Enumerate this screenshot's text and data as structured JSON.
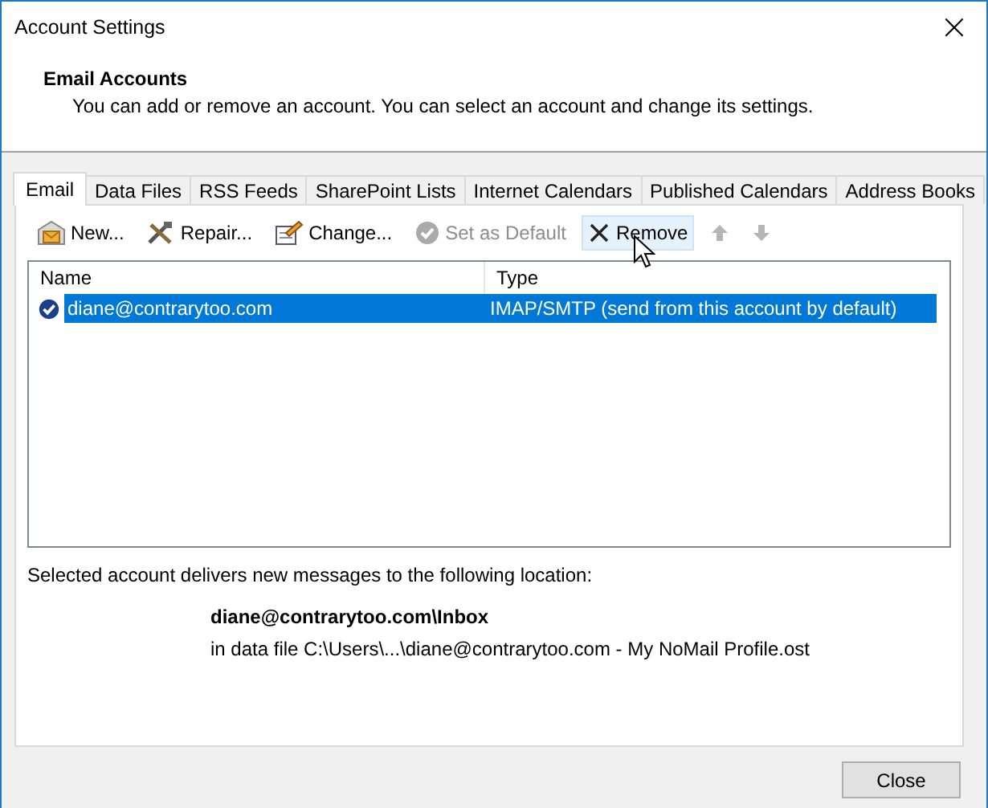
{
  "window": {
    "title": "Account Settings",
    "close": "×"
  },
  "header": {
    "title": "Email Accounts",
    "description": "You can add or remove an account. You can select an account and change its settings."
  },
  "tabs": [
    {
      "label": "Email",
      "selected": true
    },
    {
      "label": "Data Files",
      "selected": false
    },
    {
      "label": "RSS Feeds",
      "selected": false
    },
    {
      "label": "SharePoint Lists",
      "selected": false
    },
    {
      "label": "Internet Calendars",
      "selected": false
    },
    {
      "label": "Published Calendars",
      "selected": false
    },
    {
      "label": "Address Books",
      "selected": false
    }
  ],
  "toolbar": [
    {
      "kind": "new",
      "label": "New...",
      "disabled": false,
      "hovered": false
    },
    {
      "kind": "repair",
      "label": "Repair...",
      "disabled": false,
      "hovered": false
    },
    {
      "kind": "change",
      "label": "Change...",
      "disabled": false,
      "hovered": false
    },
    {
      "kind": "default",
      "label": "Set as Default",
      "disabled": true,
      "hovered": false
    },
    {
      "kind": "remove",
      "label": "Remove",
      "disabled": false,
      "hovered": true
    },
    {
      "kind": "up",
      "disabled": true,
      "hovered": false
    },
    {
      "kind": "down",
      "disabled": true,
      "hovered": false
    }
  ],
  "table": {
    "columns": [
      "Name",
      "Type"
    ],
    "rows": [
      {
        "name": "diane@contrarytoo.com",
        "type": "IMAP/SMTP (send from this account by default)",
        "selected": true,
        "default": true
      }
    ]
  },
  "location": {
    "intro": "Selected account delivers new messages to the following location:",
    "folder": "diane@contrarytoo.com\\Inbox",
    "file": "in data file C:\\Users\\...\\diane@contrarytoo.com - My NoMail Profile.ost"
  },
  "buttons": [
    {
      "label": "Close"
    }
  ]
}
